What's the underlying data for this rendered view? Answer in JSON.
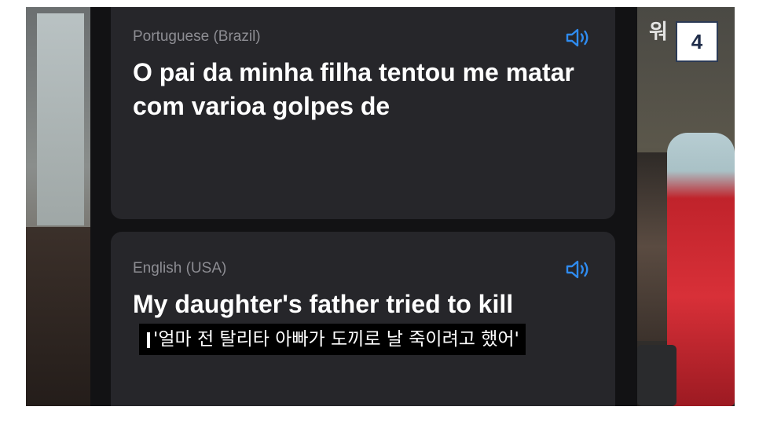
{
  "badge": {
    "number": "4"
  },
  "watermark": {
    "text": "워"
  },
  "source_card": {
    "language": "Portuguese (Brazil)",
    "text": "O pai da minha filha tentou me matar com varioa golpes de",
    "speaker_icon": "speaker-icon"
  },
  "target_card": {
    "language": "English (USA)",
    "text": "My daughter's father tried to kill",
    "speaker_icon": "speaker-icon"
  },
  "subtitle": {
    "text": "'얼마 전 탈리타 아빠가 도끼로 날 죽이려고 했어'"
  },
  "colors": {
    "accent": "#2f8cf0",
    "card_bg": "#26262a",
    "screen_bg": "#121214",
    "label_gray": "#8d8d93"
  }
}
